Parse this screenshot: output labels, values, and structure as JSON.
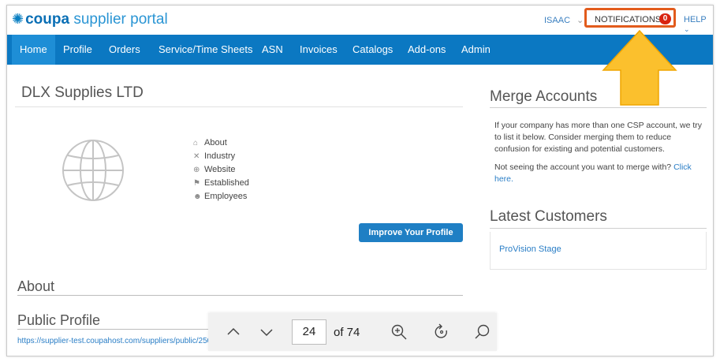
{
  "header": {
    "logo_brand": "coupa",
    "logo_rest": " supplier portal",
    "user": "ISAAC",
    "notifications_label": "NOTIFICATIONS",
    "notifications_count": "0",
    "help": "HELP"
  },
  "nav": {
    "items": [
      "Home",
      "Profile",
      "Orders",
      "Service/Time Sheets",
      "ASN",
      "Invoices",
      "Catalogs",
      "Add-ons",
      "Admin"
    ],
    "active": "Home"
  },
  "profile": {
    "company_name": "DLX Supplies LTD",
    "fields": [
      "About",
      "Industry",
      "Website",
      "Established",
      "Employees"
    ],
    "improve_button": "Improve Your Profile"
  },
  "about": {
    "heading": "About"
  },
  "public_profile": {
    "heading": "Public Profile",
    "url": "https://supplier-test.coupahost.com/suppliers/public/25059"
  },
  "merge": {
    "heading": "Merge Accounts",
    "text1": "If your company has more than one CSP account, we try to list it below. Consider merging them to reduce confusion for existing and potential customers.",
    "text2": "Not seeing the account you want to merge with?",
    "link": "Click here."
  },
  "customers": {
    "heading": "Latest Customers",
    "items": [
      "ProVision Stage"
    ]
  },
  "pdf_toolbar": {
    "page": "24",
    "of_label": "of 74"
  },
  "colors": {
    "nav_bg": "#0b78c2",
    "accent_orange": "#e25b1c",
    "arrow_yellow": "#fbc02d",
    "badge_red": "#d9230f"
  }
}
